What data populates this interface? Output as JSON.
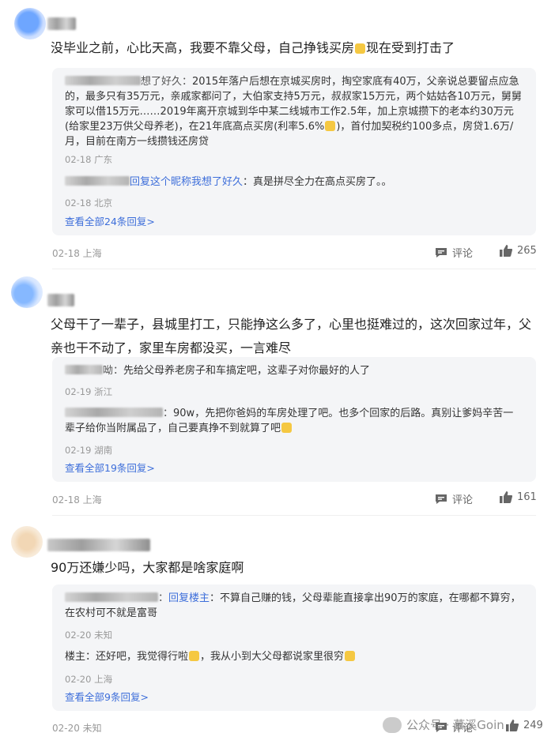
{
  "comments": [
    {
      "text": "没毕业之前，心比天高，我要不靠父母，自己挣钱买房",
      "text_after_emoji": "现在受到打击了",
      "replies": [
        {
          "name_suffix": "想了好久：",
          "text": "2015年落户后想在京城买房时，掏空家底有40万，父亲说总要留点应急的，最多只有35万元，亲戚家都问了，大伯家支持5万元，叔叔家15万元，两个姑姑各10万元，舅舅家可以借15万元……2019年离开京城到华中某二线城市工作2.5年，加上京城攒下的老本约30万元(给家里23万供父母养老)，在21年底高点买房(利率5.6%",
          "text_after_emoji": ")，首付加契税约100多点，房贷1.6万/月，目前在南方一线攒钱还房贷",
          "meta": "02-18 广东"
        },
        {
          "link": "回复这个昵称我想了好久",
          "text": "：真是拼尽全力在高点买房了。。",
          "meta": "02-18 北京"
        }
      ],
      "more": "查看全部24条回复>",
      "date": "02-18 上海",
      "comment_label": "评论",
      "likes": "265"
    },
    {
      "text": "父母干了一辈子，县城里打工，只能挣这么多了，心里也挺难过的，这次回家过年，父亲也干不动了，家里车房都没买，一言难尽",
      "replies": [
        {
          "name_suffix": "呦：",
          "text": "先给父母养老房子和车搞定吧，这辈子对你最好的人了",
          "meta": "02-19 浙江"
        },
        {
          "name_suffix": "：",
          "text": "90w，先把你爸妈的车房处理了吧。也多个回家的后路。真别让爹妈辛苦一辈子给你当附属品了，自己要真挣不到就算了吧",
          "meta": "02-19 湖南"
        }
      ],
      "more": "查看全部19条回复>",
      "date": "02-18 上海",
      "comment_label": "评论",
      "likes": "161"
    },
    {
      "text": "90万还嫌少吗，大家都是啥家庭啊",
      "replies": [
        {
          "name_suffix": "：",
          "link": "回复楼主",
          "text": "：不算自己赚的钱，父母辈能直接拿出90万的家庭，在哪都不算穷，在农村可不就是富哥",
          "meta": "02-20 未知"
        },
        {
          "name": "楼主",
          "text": "：还好吧，我觉得行啦",
          "text2": "，我从小到大父母都说家里很穷",
          "meta": "02-20 上海"
        }
      ],
      "more": "查看全部9条回复>",
      "date": "02-20 未知",
      "comment_label": "评论",
      "likes": "249"
    }
  ],
  "watermark": "公众号 · 慕溪Goin",
  "colors": {
    "link": "#3d6eda",
    "reply_bg": "#f4f5f7",
    "meta": "#999999"
  },
  "icons": [
    "comment-icon",
    "thumbs-up-icon",
    "wechat-icon"
  ]
}
